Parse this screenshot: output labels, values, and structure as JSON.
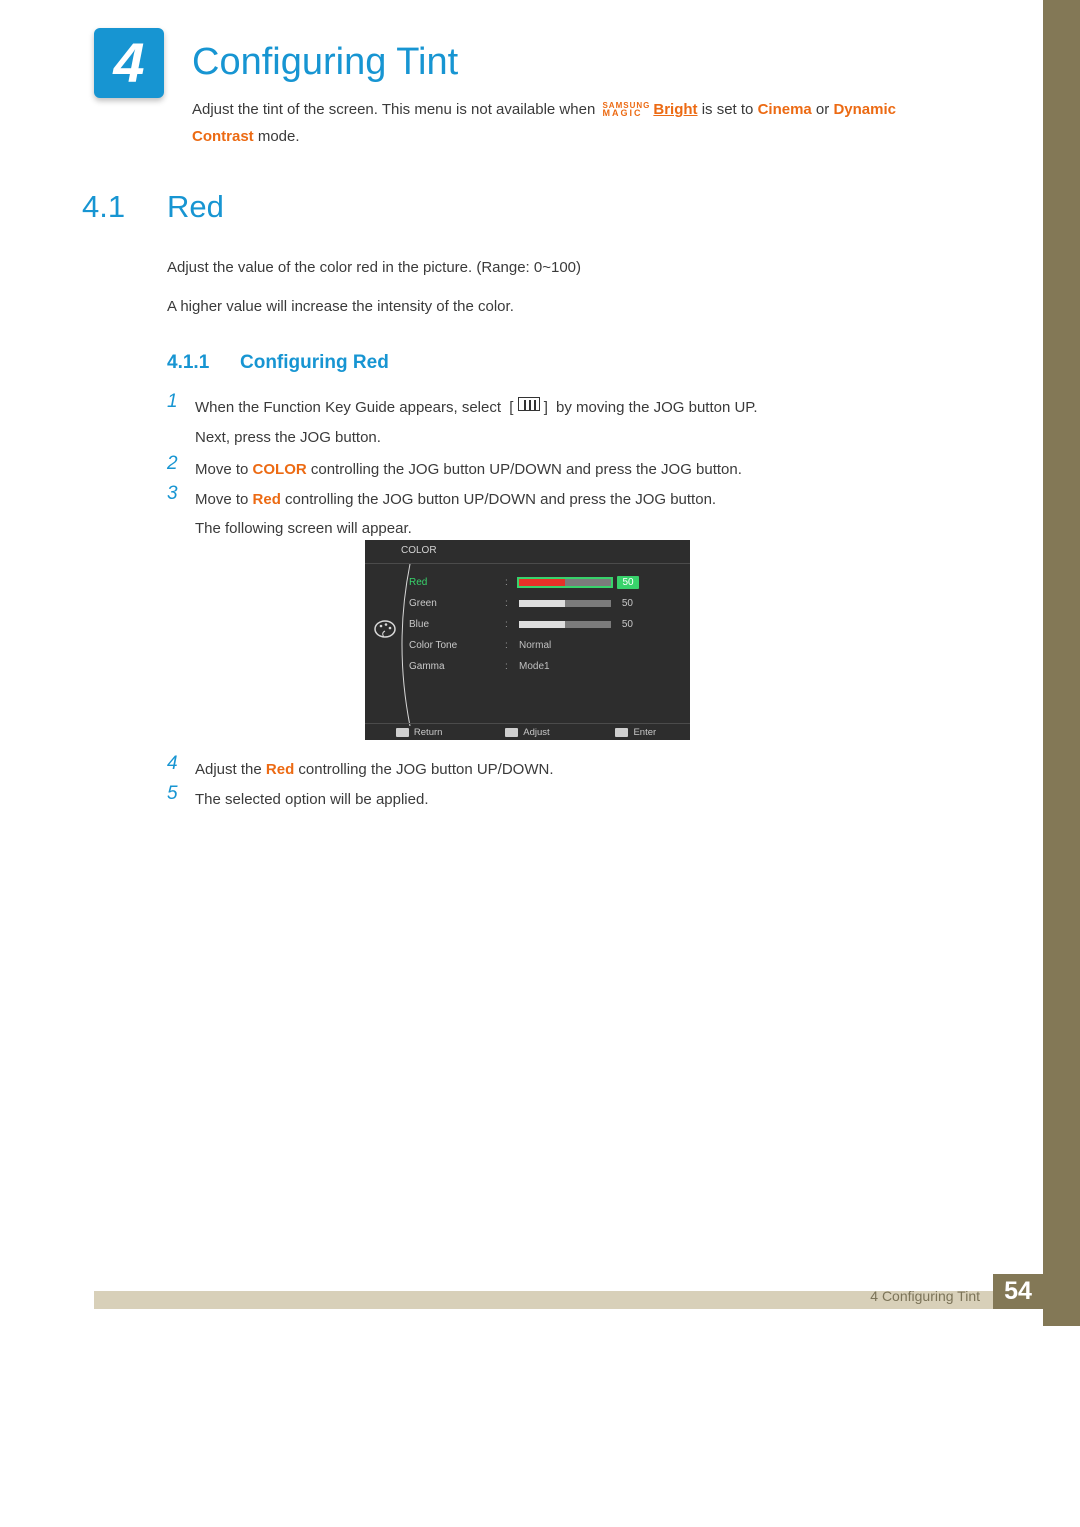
{
  "chapter": {
    "number": "4",
    "title": "Configuring Tint"
  },
  "intro": {
    "pre": "Adjust the tint of the screen. This menu is not available when ",
    "bright_word": "Bright",
    "mid": " is set to ",
    "cinema": "Cinema",
    "or": " or ",
    "dynamic": "Dynamic Contrast",
    "post": " mode.",
    "sm_top": "SAMSUNG",
    "sm_bot": "MAGIC"
  },
  "section": {
    "num": "4.1",
    "title": "Red",
    "p1": "Adjust the value of the color red in the picture. (Range: 0~100)",
    "p2": "A higher value will increase the intensity of the color."
  },
  "subsection": {
    "num": "4.1.1",
    "title": "Configuring Red"
  },
  "steps": {
    "s1_num": "1",
    "s1a": "When the Function Key Guide appears, select ",
    "s1b": " by moving the JOG button UP.",
    "s1c": "Next, press the JOG button.",
    "s2_num": "2",
    "s2a": "Move to ",
    "s2_color": "COLOR",
    "s2b": " controlling the JOG button UP/DOWN and press the JOG button.",
    "s3_num": "3",
    "s3a": "Move to ",
    "s3_red": "Red",
    "s3b": " controlling the JOG button UP/DOWN and press the JOG button.",
    "s3c": "The following screen will appear.",
    "s4_num": "4",
    "s4a": "Adjust the ",
    "s4_red": "Red",
    "s4b": " controlling the JOG button UP/DOWN.",
    "s5_num": "5",
    "s5": "The selected option will be applied."
  },
  "osd": {
    "title": "COLOR",
    "rows": {
      "red": {
        "label": "Red",
        "value": "50"
      },
      "green": {
        "label": "Green",
        "value": "50"
      },
      "blue": {
        "label": "Blue",
        "value": "50"
      },
      "tone": {
        "label": "Color Tone",
        "value": "Normal"
      },
      "gamma": {
        "label": "Gamma",
        "value": "Mode1"
      }
    },
    "footer": {
      "return": "Return",
      "adjust": "Adjust",
      "enter": "Enter"
    }
  },
  "footer": {
    "text": "4 Configuring Tint",
    "page": "54"
  }
}
